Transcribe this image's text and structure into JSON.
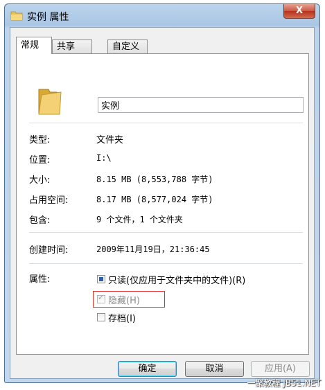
{
  "window": {
    "title": "实例 属性",
    "close_label": "X"
  },
  "tabs": [
    {
      "label": "常规",
      "active": true
    },
    {
      "label": "共享",
      "active": false
    },
    {
      "label": "自定义",
      "active": false
    }
  ],
  "general": {
    "folder_name": "实例",
    "type_label": "类型:",
    "type_value": "文件夹",
    "location_label": "位置:",
    "location_value": "I:\\",
    "size_label": "大小:",
    "size_value": "8.15 MB (8,553,788 字节)",
    "disk_size_label": "占用空间:",
    "disk_size_value": "8.17 MB (8,577,024 字节)",
    "contains_label": "包含:",
    "contains_value": "9 个文件，1 个文件夹",
    "created_label": "创建时间:",
    "created_value": "2009年11月19日，21:36:45",
    "attributes_label": "属性:",
    "readonly_label": "只读(仅应用于文件夹中的文件)(R)",
    "hidden_label": "隐藏(H)",
    "archive_label": "存档(I)"
  },
  "buttons": {
    "ok": "确定",
    "cancel": "取消",
    "apply": "应用(A)"
  },
  "watermark": "一聚教程 JB51.NET",
  "colors": {
    "highlight_box": "#e0302f",
    "title_bar": "#a9c6e4",
    "close_button": "#c75944"
  }
}
